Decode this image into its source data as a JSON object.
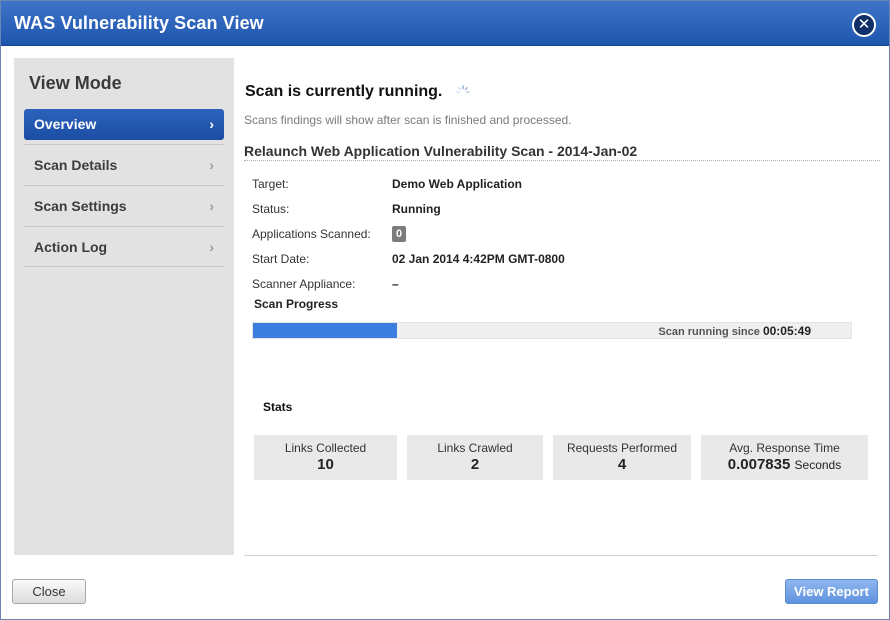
{
  "window": {
    "title": "WAS Vulnerability Scan View",
    "close_icon": "close-icon"
  },
  "sidebar": {
    "title": "View Mode",
    "items": [
      {
        "label": "Overview",
        "active": true
      },
      {
        "label": "Scan Details",
        "active": false
      },
      {
        "label": "Scan Settings",
        "active": false
      },
      {
        "label": "Action Log",
        "active": false
      }
    ],
    "chevron": "›"
  },
  "main": {
    "heading": "Scan is currently running.",
    "subtext": "Scans findings will show after scan is finished and processed.",
    "scan_title": "Relaunch Web Application Vulnerability Scan - 2014-Jan-02",
    "details": [
      {
        "label": "Target:",
        "value": "Demo Web Application"
      },
      {
        "label": "Status:",
        "value": "Running"
      },
      {
        "label": "Applications Scanned:",
        "value": "0"
      },
      {
        "label": "Start Date:",
        "value": "02 Jan 2014 4:42PM GMT-0800"
      },
      {
        "label": "Scanner Appliance:",
        "value": "–"
      }
    ],
    "progress": {
      "label": "Scan Progress",
      "fraction": 0.24,
      "running_text": "Scan running since",
      "elapsed": "00:05:49",
      "fill_color": "#3a7ee0"
    },
    "stats": {
      "title": "Stats",
      "items": [
        {
          "label": "Links Collected",
          "value": "10",
          "unit": ""
        },
        {
          "label": "Links Crawled",
          "value": "2",
          "unit": ""
        },
        {
          "label": "Requests Performed",
          "value": "4",
          "unit": ""
        },
        {
          "label": "Avg. Response Time",
          "value": "0.007835",
          "unit": "Seconds"
        }
      ]
    }
  },
  "footer": {
    "close_label": "Close",
    "report_label": "View Report"
  },
  "colors": {
    "title_bar": "#2a62bd",
    "active_nav": "#2458b0",
    "report_button": "#74a3e6"
  }
}
